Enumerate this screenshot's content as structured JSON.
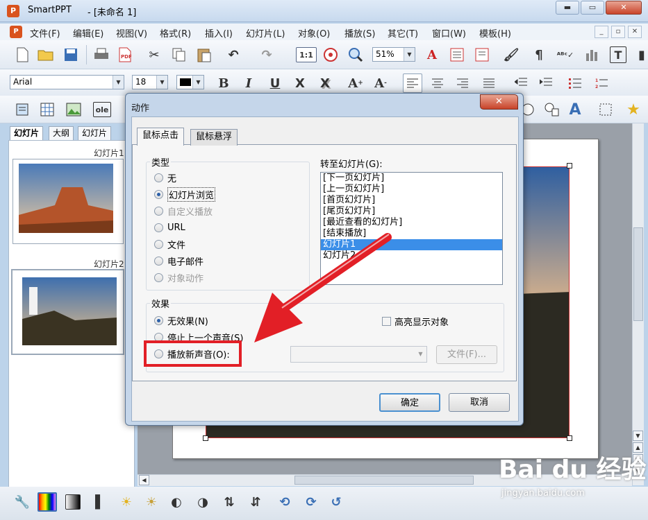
{
  "window": {
    "app_name": "SmartPPT",
    "doc_title": "- [未命名 1]",
    "min": "▬",
    "max": "▭",
    "close": "✕"
  },
  "menu": {
    "items": [
      "文件(F)",
      "编辑(E)",
      "视图(V)",
      "格式(R)",
      "插入(I)",
      "幻灯片(L)",
      "对象(O)",
      "播放(S)",
      "其它(T)",
      "窗口(W)",
      "模板(H)"
    ],
    "mdi_min": "_",
    "mdi_restore": "▫",
    "mdi_close": "✕"
  },
  "toolbar1": {
    "ratio_label": "1:1",
    "zoom_value": "51%"
  },
  "toolbar2": {
    "font_name": "Arial",
    "font_size": "18",
    "bold": "B",
    "italic": "I",
    "underline": "U",
    "strike": "X",
    "shadow": "X"
  },
  "panel": {
    "tabs": [
      "幻灯片",
      "大纲",
      "幻灯片"
    ],
    "slide1_label": "幻灯片1",
    "slide2_label": "幻灯片2"
  },
  "dialog": {
    "title": "动作",
    "close": "✕",
    "tabs": [
      "鼠标点击",
      "鼠标悬浮"
    ],
    "type_group": {
      "title": "类型",
      "options": [
        {
          "label": "无",
          "checked": false,
          "disabled": false
        },
        {
          "label": "幻灯片浏览",
          "checked": true,
          "disabled": false
        },
        {
          "label": "自定义播放",
          "checked": false,
          "disabled": true
        },
        {
          "label": "URL",
          "checked": false,
          "disabled": false
        },
        {
          "label": "文件",
          "checked": false,
          "disabled": false
        },
        {
          "label": "电子邮件",
          "checked": false,
          "disabled": false
        },
        {
          "label": "对象动作",
          "checked": false,
          "disabled": true
        }
      ]
    },
    "goto_label": "转至幻灯片(G):",
    "goto_list": [
      "[下一页幻灯片]",
      "[上一页幻灯片]",
      "[首页幻灯片]",
      "[尾页幻灯片]",
      "[最近查看的幻灯片]",
      "[结束播放]",
      "幻灯片1",
      "幻灯片2"
    ],
    "goto_selected": "幻灯片1",
    "effect_group": {
      "title": "效果",
      "no_effect": "无效果(N)",
      "stop_sound": "停止上一个声音(S)",
      "play_sound": "播放新声音(O):",
      "highlight": "高亮显示对象",
      "file_button": "文件(F)..."
    },
    "ok": "确定",
    "cancel": "取消"
  },
  "watermark": {
    "brand": "Bai du 经验",
    "url": "jingyan.baidu.com"
  },
  "colors": {
    "accent_red": "#e21f26",
    "selection": "#3b8ee8",
    "titlebar": "#c7d9ee"
  }
}
